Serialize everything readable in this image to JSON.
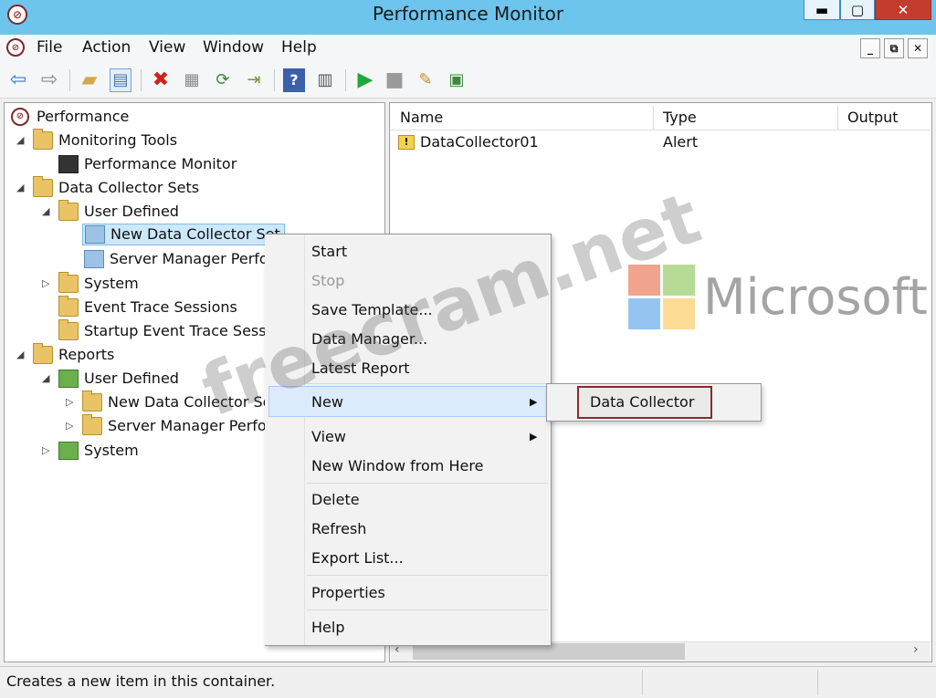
{
  "window": {
    "title": "Performance Monitor",
    "min_glyph": "▬",
    "max_glyph": "▢",
    "close_glyph": "✕"
  },
  "menubar": {
    "items": [
      "File",
      "Action",
      "View",
      "Window",
      "Help"
    ]
  },
  "tree": {
    "root": "Performance",
    "monitoring_tools": "Monitoring Tools",
    "performance_monitor": "Performance Monitor",
    "data_collector_sets": "Data Collector Sets",
    "user_defined": "User Defined",
    "new_dcs": "New Data Collector Set",
    "server_manager": "Server Manager Perfor",
    "system": "System",
    "event_trace": "Event Trace Sessions",
    "startup_trace": "Startup Event Trace Sessions",
    "reports": "Reports",
    "reports_user_defined": "User Defined",
    "reports_new_dcs": "New Data Collector Se",
    "reports_server_manager": "Server Manager Perfo",
    "reports_system": "System"
  },
  "list": {
    "columns": [
      "Name",
      "Type",
      "Output"
    ],
    "rows": [
      {
        "name": "DataCollector01",
        "type": "Alert"
      }
    ]
  },
  "context_menu": {
    "start": "Start",
    "stop": "Stop",
    "save_template": "Save Template...",
    "data_manager": "Data Manager...",
    "latest_report": "Latest Report",
    "new": "New",
    "view": "View",
    "new_window": "New Window from Here",
    "delete": "Delete",
    "refresh": "Refresh",
    "export_list": "Export List...",
    "properties": "Properties",
    "help": "Help"
  },
  "submenu": {
    "data_collector": "Data Collector"
  },
  "status": {
    "text": "Creates a new item in this container."
  },
  "watermark": {
    "text": "freecram.net",
    "brand": "Microsoft"
  },
  "colors": {
    "titlebar": "#6dc4ed",
    "highlight": "#dcebfb",
    "submenu_border": "#8a2a2a"
  }
}
